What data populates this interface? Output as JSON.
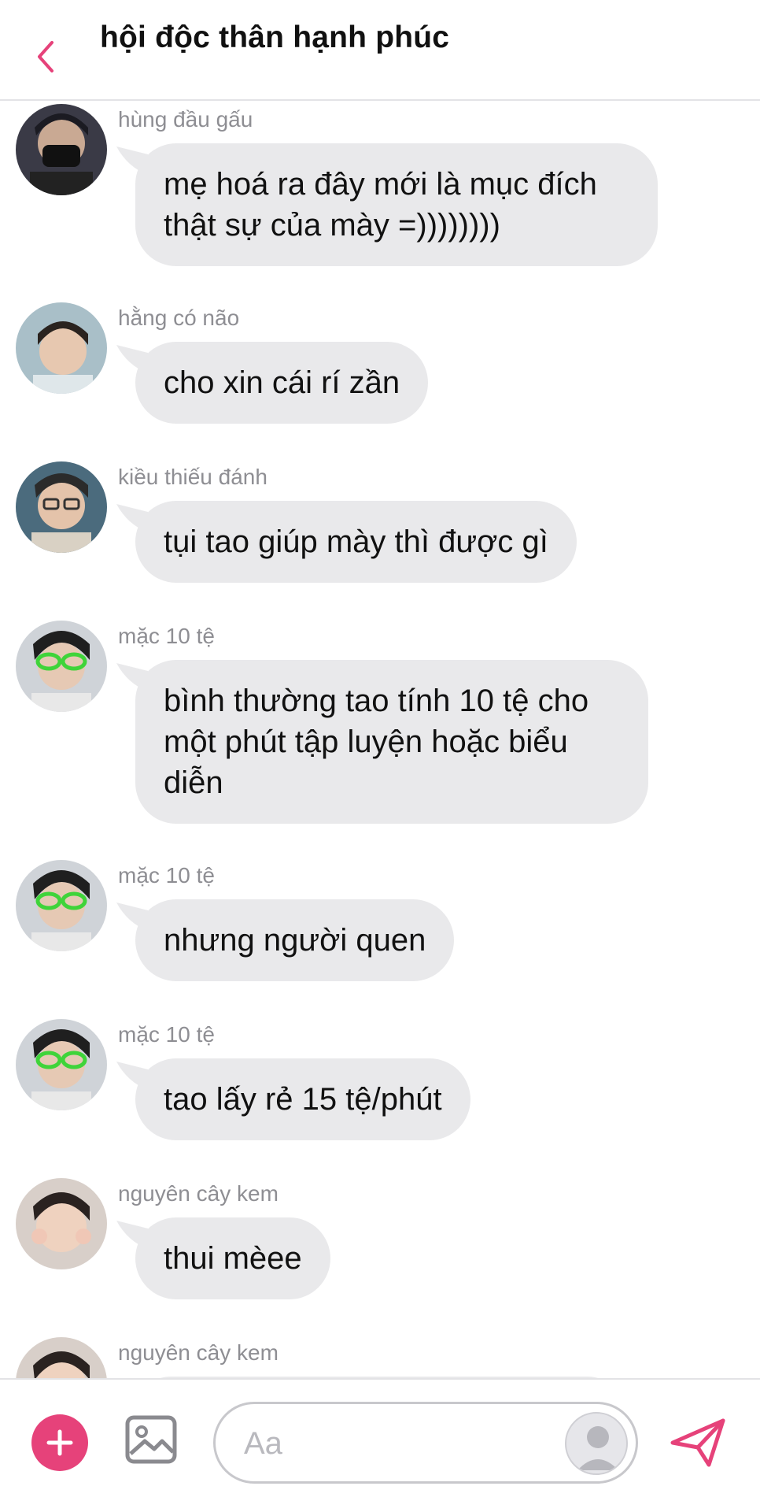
{
  "header": {
    "title": "hội độc thân hạnh phúc",
    "back_icon": "chevron-left-icon"
  },
  "colors": {
    "accent": "#e6427a",
    "bubble": "#e9e9eb",
    "sender": "#8e8e93"
  },
  "messages": [
    {
      "sender": "hùng đầu gấu",
      "lines": [
        "mẹ hoá ra đây mới là mục đích",
        "thật sự của mày =))))))))"
      ]
    },
    {
      "sender": "hằng có não",
      "lines": [
        "cho xin cái rí zần"
      ]
    },
    {
      "sender": "kiều thiếu đánh",
      "lines": [
        "tụi tao giúp mày thì được gì"
      ]
    },
    {
      "sender": "mặc 10 tệ",
      "lines": [
        "bình thường tao tính 10 tệ cho",
        "một phút tập luyện hoặc biểu",
        "diễn"
      ]
    },
    {
      "sender": "mặc 10 tệ",
      "lines": [
        "nhưng người quen"
      ]
    },
    {
      "sender": "mặc 10 tệ",
      "lines": [
        "tao lấy rẻ 15 tệ/phút"
      ]
    },
    {
      "sender": "nguyên cây kem",
      "lines": [
        "thui mèee"
      ]
    },
    {
      "sender": "nguyên cây kem",
      "lines": []
    }
  ],
  "composer": {
    "placeholder": "Aa",
    "plus_icon": "plus-icon",
    "image_icon": "image-icon",
    "send_icon": "send-icon"
  }
}
